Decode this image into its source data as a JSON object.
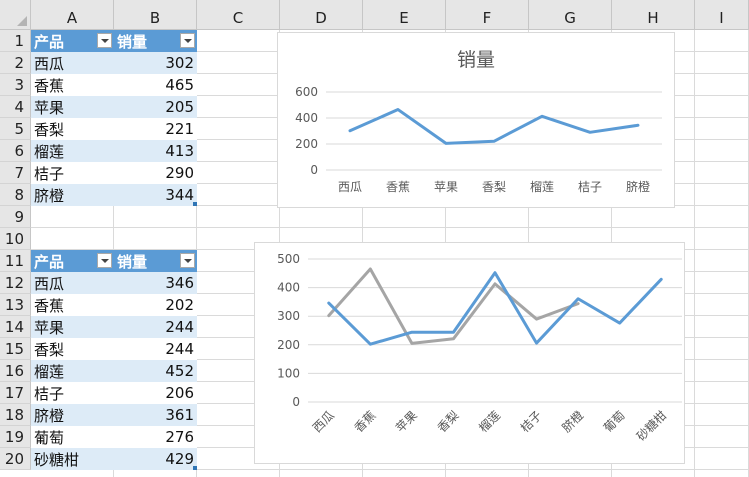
{
  "sheet": {
    "columns": [
      "A",
      "B",
      "C",
      "D",
      "E",
      "F",
      "G",
      "H",
      "I"
    ],
    "rows": [
      "1",
      "2",
      "3",
      "4",
      "5",
      "6",
      "7",
      "8",
      "9",
      "10",
      "11",
      "12",
      "13",
      "14",
      "15",
      "16",
      "17",
      "18",
      "19",
      "20"
    ]
  },
  "table1": {
    "headers": [
      "产品",
      "销量"
    ],
    "rows": [
      {
        "product": "西瓜",
        "sales": "302"
      },
      {
        "product": "香蕉",
        "sales": "465"
      },
      {
        "product": "苹果",
        "sales": "205"
      },
      {
        "product": "香梨",
        "sales": "221"
      },
      {
        "product": "榴莲",
        "sales": "413"
      },
      {
        "product": "桔子",
        "sales": "290"
      },
      {
        "product": "脐橙",
        "sales": "344"
      }
    ]
  },
  "table2": {
    "headers": [
      "产品",
      "销量"
    ],
    "rows": [
      {
        "product": "西瓜",
        "sales": "346"
      },
      {
        "product": "香蕉",
        "sales": "202"
      },
      {
        "product": "苹果",
        "sales": "244"
      },
      {
        "product": "香梨",
        "sales": "244"
      },
      {
        "product": "榴莲",
        "sales": "452"
      },
      {
        "product": "桔子",
        "sales": "206"
      },
      {
        "product": "脐橙",
        "sales": "361"
      },
      {
        "product": "葡萄",
        "sales": "276"
      },
      {
        "product": "砂糖柑",
        "sales": "429"
      }
    ]
  },
  "colors": {
    "blue_series": "#5b9bd5",
    "gray_series": "#a5a5a5",
    "header_fill": "#5b9bd5",
    "band_fill": "#ddebf7"
  },
  "chart_data": [
    {
      "type": "line",
      "title": "销量",
      "categories": [
        "西瓜",
        "香蕉",
        "苹果",
        "香梨",
        "榴莲",
        "桔子",
        "脐橙"
      ],
      "series": [
        {
          "values": [
            302,
            465,
            205,
            221,
            413,
            290,
            344
          ],
          "color": "#5b9bd5"
        }
      ],
      "yticks": [
        "0",
        "200",
        "400",
        "600"
      ],
      "ylim": [
        0,
        600
      ],
      "grid": true,
      "legend": "none"
    },
    {
      "type": "line",
      "title": "",
      "categories": [
        "西瓜",
        "香蕉",
        "苹果",
        "香梨",
        "榴莲",
        "桔子",
        "脐橙",
        "葡萄",
        "砂糖柑"
      ],
      "series": [
        {
          "values": [
            346,
            202,
            244,
            244,
            452,
            206,
            361,
            276,
            429
          ],
          "color": "#5b9bd5"
        },
        {
          "values": [
            302,
            465,
            205,
            221,
            413,
            290,
            344
          ],
          "color": "#a5a5a5"
        }
      ],
      "yticks": [
        "0",
        "100",
        "200",
        "300",
        "400",
        "500"
      ],
      "ylim": [
        0,
        500
      ],
      "grid": true,
      "legend": "none"
    }
  ]
}
